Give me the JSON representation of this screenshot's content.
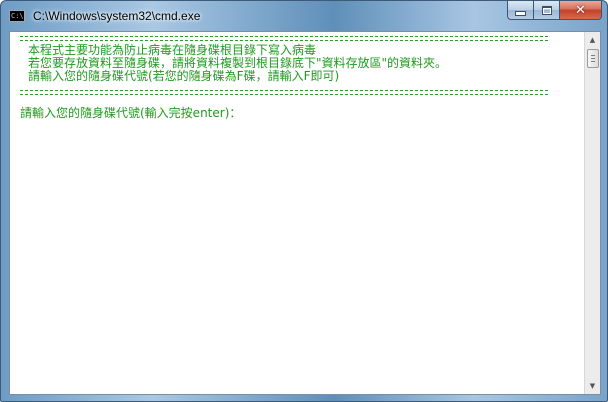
{
  "window": {
    "title": "C:\\Windows\\system32\\cmd.exe",
    "icon": "cmd-icon",
    "icon_text": "C:\\"
  },
  "caption": {
    "minimize_icon": "minimize-icon",
    "maximize_icon": "maximize-icon",
    "close_icon": "close-icon",
    "close_glyph": "✕"
  },
  "console": {
    "text_color": "#1f9a1f",
    "background": "#ffffff",
    "line1": "本程式主要功能為防止病毒在隨身碟根目錄下寫入病毒",
    "line2": "若您要存放資料至隨身碟，請將資料複製到根目錄底下\"資料存放區\"的資料夾。",
    "line3": "請輸入您的隨身碟代號(若您的隨身碟為F碟，請輸入F即可)",
    "prompt": "請輸入您的隨身碟代號(輸入完按enter)："
  },
  "scrollbar": {
    "up_arrow": "▲",
    "down_arrow": "▼"
  }
}
